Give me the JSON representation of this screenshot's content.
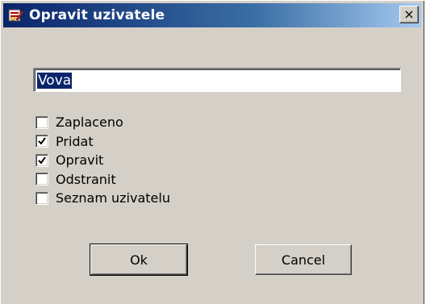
{
  "window": {
    "title": "Opravit uzivatele",
    "close_glyph": "×",
    "icon": "app-icon"
  },
  "form": {
    "name_value": "Vova",
    "checkboxes": [
      {
        "label": "Zaplaceno",
        "checked": false
      },
      {
        "label": "Pridat",
        "checked": true
      },
      {
        "label": "Opravit",
        "checked": true
      },
      {
        "label": "Odstranit",
        "checked": false
      },
      {
        "label": "Seznam uzivatelu",
        "checked": false
      }
    ]
  },
  "buttons": {
    "ok_label": "Ok",
    "cancel_label": "Cancel"
  },
  "colors": {
    "titlebar_start": "#0a246a",
    "titlebar_end": "#a6caf0",
    "face": "#d4d0c8",
    "selection": "#0a246a"
  }
}
